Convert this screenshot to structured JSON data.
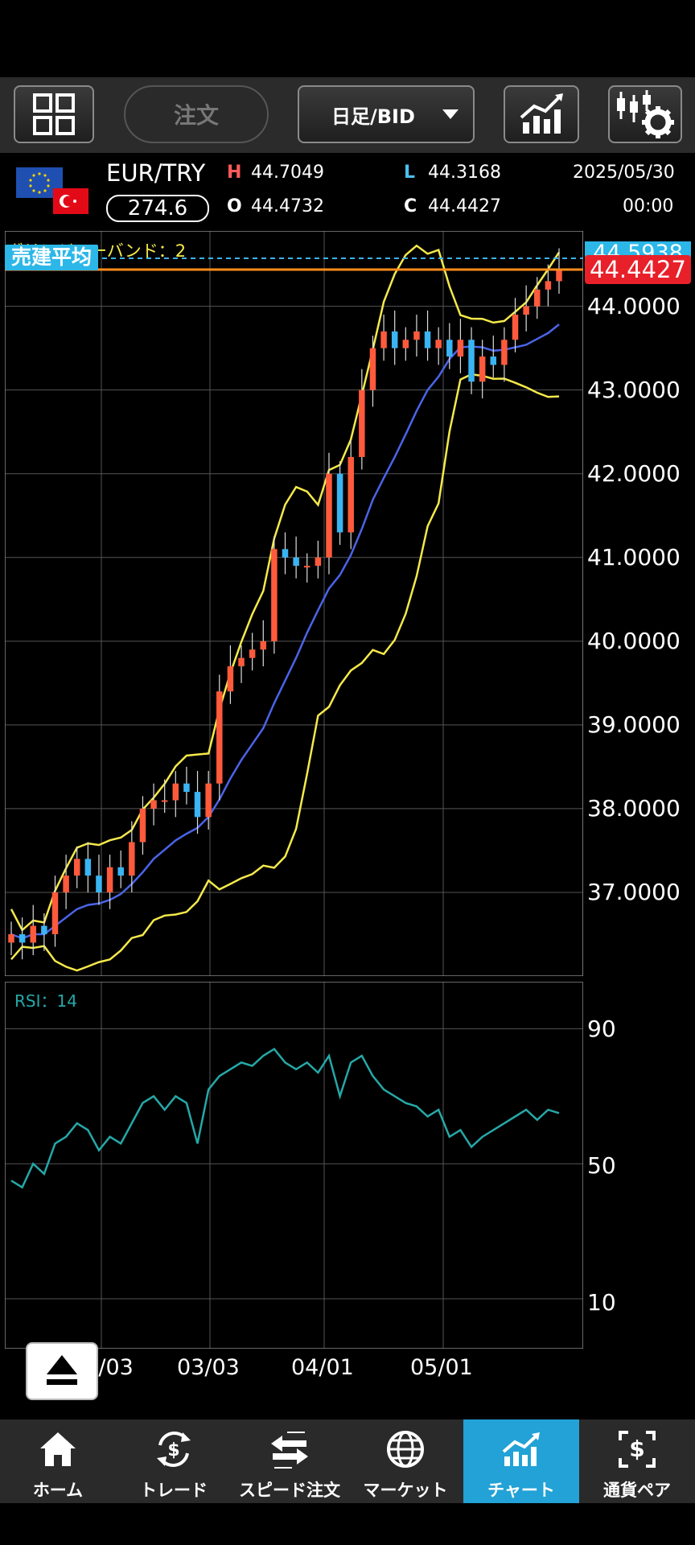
{
  "toolbar": {
    "order_label": "注文",
    "timeframe_label": "日足/BID"
  },
  "symbol": {
    "pair": "EUR/TRY",
    "spread": "274.6",
    "high_label": "H",
    "high": "44.7049",
    "low_label": "L",
    "low": "44.3168",
    "open_label": "O",
    "open": "44.4732",
    "close_label": "C",
    "close": "44.4427",
    "date": "2025/05/30",
    "time": "00:00"
  },
  "chart": {
    "indicator_label": "ボリンジャーバンド：2",
    "avg_label": "売建平均",
    "price_tag_top": "44.5938",
    "price_tag_current": "44.4427",
    "y_labels": [
      "44.0000",
      "43.0000",
      "42.0000",
      "41.0000",
      "40.0000",
      "39.0000",
      "38.0000",
      "37.0000"
    ],
    "rsi_label": "RSI：14",
    "rsi_levels": [
      "90",
      "50",
      "10"
    ],
    "date_labels": [
      "02/03",
      "03/03",
      "04/01",
      "05/01"
    ]
  },
  "chart_data": [
    {
      "type": "candlestick",
      "title": "EUR/TRY 日足/BID",
      "ylim": [
        36.0,
        44.9
      ],
      "indicators": [
        "Bollinger Bands (2σ)",
        "moving average"
      ],
      "last_close": 44.4427,
      "x_ticks": [
        "02/03",
        "03/03",
        "04/01",
        "05/01"
      ],
      "series": [
        {
          "name": "close_approx",
          "values": [
            36.5,
            36.4,
            36.6,
            36.5,
            37.0,
            37.2,
            37.4,
            37.2,
            37.0,
            37.3,
            37.2,
            37.6,
            38.0,
            38.1,
            38.1,
            38.3,
            38.2,
            37.9,
            38.3,
            39.4,
            39.7,
            39.8,
            39.9,
            40.0,
            41.1,
            41.0,
            40.9,
            40.9,
            41.0,
            42.0,
            41.3,
            42.2,
            43.0,
            43.5,
            43.7,
            43.5,
            43.6,
            43.7,
            43.5,
            43.6,
            43.4,
            43.6,
            43.1,
            43.4,
            43.3,
            43.6,
            43.9,
            44.0,
            44.2,
            44.3,
            44.4427
          ]
        }
      ]
    },
    {
      "type": "line",
      "title": "RSI：14",
      "ylim": [
        0,
        100
      ],
      "y_ticks": [
        10,
        50,
        90
      ],
      "series": [
        {
          "name": "RSI",
          "values": [
            45,
            43,
            50,
            47,
            56,
            58,
            62,
            60,
            54,
            58,
            56,
            62,
            68,
            70,
            66,
            70,
            68,
            56,
            72,
            76,
            78,
            80,
            79,
            82,
            84,
            80,
            78,
            80,
            77,
            82,
            70,
            80,
            82,
            76,
            72,
            70,
            68,
            67,
            64,
            66,
            58,
            60,
            55,
            58,
            60,
            62,
            64,
            66,
            63,
            66,
            65
          ]
        }
      ]
    }
  ],
  "nav": [
    {
      "label": "ホーム",
      "icon": "home-icon"
    },
    {
      "label": "トレード",
      "icon": "trade-icon"
    },
    {
      "label": "スピード注文",
      "icon": "speed-order-icon"
    },
    {
      "label": "マーケット",
      "icon": "market-icon"
    },
    {
      "label": "チャート",
      "icon": "chart-icon"
    },
    {
      "label": "通貨ペア",
      "icon": "currency-pair-icon"
    }
  ],
  "colors": {
    "up": "#ff5a3c",
    "down": "#3ab4f2",
    "bollinger": "#f5e94a",
    "ma": "#4a64e8",
    "rsi": "#26a8a8",
    "avg_line": "#ff8c1a",
    "price_tag": "#e8202a",
    "accent": "#22a2d6"
  }
}
